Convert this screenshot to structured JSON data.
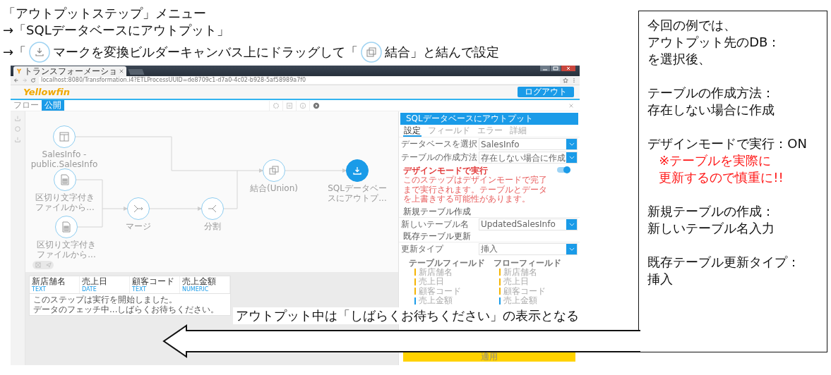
{
  "heading": {
    "lines": [
      "「アウトプットステップ」メニュー",
      "→「SQLデータベースにアウトプット」"
    ],
    "drag_line": {
      "before": "→「",
      "middle": "マークを変換ビルダーキャンバス上にドラッグして「",
      "after": "結合」と結んで設定"
    }
  },
  "browser": {
    "tab_title": "トランスフォーメーショ",
    "url": "localhost:8080/Transformation.i4?ETLProcessUUID=de8709c1-d7a0-4c02-b928-5af58989a7f0"
  },
  "app": {
    "logo": "Yellowfin",
    "logout": "ログアウト",
    "tabs": [
      {
        "label": "フロー",
        "selected": false
      },
      {
        "label": "公開",
        "selected": true
      }
    ]
  },
  "flow": {
    "nodes": [
      {
        "kind": "table",
        "label_lines": [
          "SalesInfo -",
          "public.SalesInfo"
        ],
        "selected": false
      },
      {
        "kind": "file",
        "label_lines": [
          "区切り文字付き",
          "ファイルから..."
        ],
        "selected": false
      },
      {
        "kind": "file",
        "label_lines": [
          "区切り文字付き",
          "ファイルから..."
        ],
        "selected": false
      },
      {
        "kind": "merge",
        "label_lines": [
          "マージ"
        ],
        "selected": false
      },
      {
        "kind": "split",
        "label_lines": [
          "分割"
        ],
        "selected": false
      },
      {
        "kind": "union",
        "label_lines": [
          "結合(Union)"
        ],
        "selected": false
      },
      {
        "kind": "output",
        "label_lines": [
          "SQLデータベー",
          "スにアウトプ..."
        ],
        "selected": true
      }
    ]
  },
  "preview": {
    "columns": [
      {
        "name": "新店舗名",
        "type": "TEXT"
      },
      {
        "name": "売上日",
        "type": "DATE"
      },
      {
        "name": "顧客コード",
        "type": "TEXT"
      },
      {
        "name": "売上金額",
        "type": "NUMERIC"
      }
    ],
    "messages": [
      "このステップは実行を開始しました。",
      "データのフェッチ中...しばらくお待ちください。"
    ]
  },
  "panel": {
    "title": "SQLデータベースにアウトプット",
    "tabs": [
      {
        "label": "設定",
        "selected": true
      },
      {
        "label": "フィールド",
        "selected": false
      },
      {
        "label": "エラー",
        "selected": false
      },
      {
        "label": "詳細",
        "selected": false
      }
    ],
    "database": {
      "label": "データベースを選択",
      "value": "SalesInfo"
    },
    "create_method": {
      "label": "テーブルの作成方法",
      "value": "存在しない場合に作成"
    },
    "design_mode": {
      "title": "デザインモードで実行",
      "description": "このステップはデザインモードで完了まで実行されます。テーブルとデータを上書きする可能性があります。",
      "on": true
    },
    "new_table": {
      "section": "新規テーブル作成",
      "label": "新しいテーブル名",
      "value": "UpdatedSalesInfo"
    },
    "existing_table": {
      "section": "既存テーブル更新",
      "label": "更新タイプ",
      "value": "挿入"
    },
    "mapping": {
      "table_header": "テーブルフィールド",
      "flow_header": "フローフィールド",
      "table_fields": [
        {
          "name": "新店舗名",
          "color": "#f5b400"
        },
        {
          "name": "売上日",
          "color": "#f5b400"
        },
        {
          "name": "顧客コード",
          "color": "#f5b400"
        },
        {
          "name": "売上金額",
          "color": "#1a9be8"
        }
      ],
      "flow_fields": [
        {
          "name": "新店舗名",
          "color": "#f5b400"
        },
        {
          "name": "売上日",
          "color": "#f5b400"
        },
        {
          "name": "顧客コード",
          "color": "#f5b400"
        },
        {
          "name": "売上金額",
          "color": "#1a9be8"
        }
      ]
    },
    "apply": "適用"
  },
  "callout": "アウトプット中は「しばらくお待ちください」の表示となる",
  "notes": [
    {
      "lines": [
        {
          "text": "今回の例では、",
          "kind": "normal"
        },
        {
          "text": "アウトプット先のDB：",
          "kind": "normal"
        },
        {
          "text": "を選択後、",
          "kind": "normal"
        }
      ]
    },
    {
      "lines": [
        {
          "text": "テーブルの作成方法：",
          "kind": "normal"
        },
        {
          "text": "存在しない場合に作成",
          "kind": "normal"
        }
      ]
    },
    {
      "lines": [
        {
          "text": "デザインモードで実行：ON",
          "kind": "normal"
        },
        {
          "text": "※テーブルを実際に",
          "kind": "warning"
        },
        {
          "text": "更新するので慎重に!!",
          "kind": "warning"
        }
      ]
    },
    {
      "lines": [
        {
          "text": "新規テーブルの作成：",
          "kind": "normal"
        },
        {
          "text": "新しいテーブル名入力",
          "kind": "normal"
        }
      ]
    },
    {
      "lines": [
        {
          "text": "既存テーブル更新タイプ：",
          "kind": "normal"
        },
        {
          "text": "挿入",
          "kind": "normal"
        }
      ]
    }
  ]
}
